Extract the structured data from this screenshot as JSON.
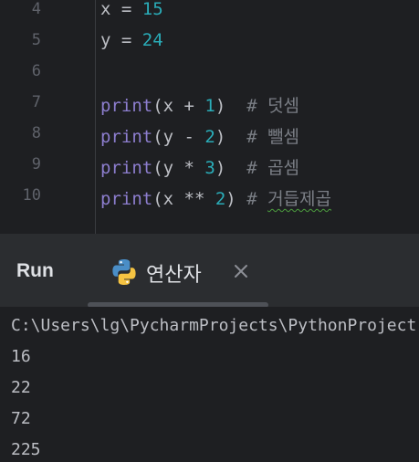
{
  "editor": {
    "lines": [
      {
        "num": "4",
        "var": "x",
        "eq": " = ",
        "val": "15"
      },
      {
        "num": "5",
        "var": "y",
        "eq": " = ",
        "val": "24"
      },
      {
        "num": "6"
      },
      {
        "num": "7",
        "fn": "print",
        "open": "(x + ",
        "arg": "1",
        "close": ")  ",
        "comment": "# 덧셈"
      },
      {
        "num": "8",
        "fn": "print",
        "open": "(y - ",
        "arg": "2",
        "close": ")  ",
        "comment": "# 뺄셈"
      },
      {
        "num": "9",
        "fn": "print",
        "open": "(y * ",
        "arg": "3",
        "close": ")  ",
        "comment": "# 곱셈"
      },
      {
        "num": "10",
        "fn": "print",
        "open": "(x ** ",
        "arg": "2",
        "close": ") ",
        "comment_hash": "# ",
        "comment_word": "거듭제곱"
      }
    ]
  },
  "run_panel": {
    "title": "Run",
    "tab_label": "연산자",
    "tab_icon": "python-icon",
    "close_icon": "close-icon"
  },
  "console": {
    "lines": [
      "C:\\Users\\lg\\PycharmProjects\\PythonProject",
      "16",
      "22",
      "72",
      "225"
    ]
  },
  "colors": {
    "editor_bg": "#1e1f22",
    "panel_bg": "#2b2d30",
    "function": "#8d7ecf",
    "number": "#2aacb8",
    "comment": "#7a7e85",
    "text": "#bcbec4"
  }
}
